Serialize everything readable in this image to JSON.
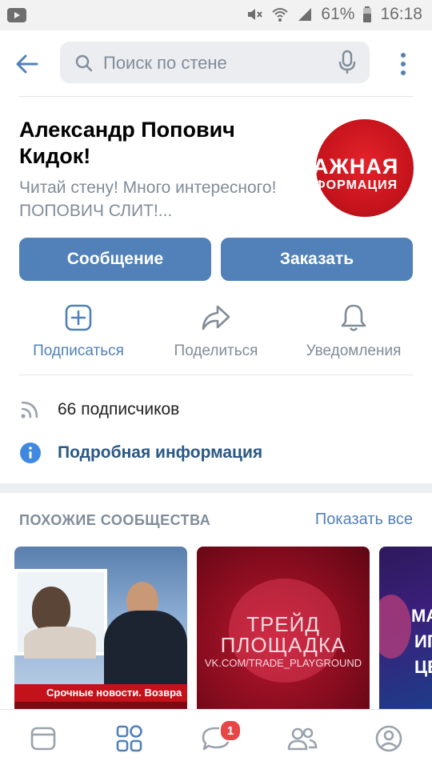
{
  "status_bar": {
    "battery": "61%",
    "time": "16:18"
  },
  "search": {
    "placeholder": "Поиск по стене"
  },
  "group": {
    "name": "Александр Попович Кидок!",
    "status": "Читай стену! Много интересного! ПОПОВИЧ СЛИТ!...",
    "avatar_text_1": "АЖНАЯ",
    "avatar_text_2": "ФОРМАЦИЯ"
  },
  "buttons": {
    "message": "Сообщение",
    "order": "Заказать"
  },
  "actions": [
    {
      "label": "Подписаться",
      "icon": "plus-square-icon"
    },
    {
      "label": "Поделиться",
      "icon": "share-arrow-icon"
    },
    {
      "label": "Уведомления",
      "icon": "bell-icon"
    }
  ],
  "info": {
    "subscribers": "66 подписчиков",
    "details": "Подробная информация"
  },
  "similar": {
    "title": "ПОХОЖИЕ СООБЩЕСТВА",
    "show_all": "Показать все",
    "cards": [
      {
        "banner": "Срочные новости. Возвра"
      },
      {
        "line1": "ТРЕЙД",
        "line2": "ПЛОЩАДКА",
        "line3": "VK.COM/TRADE_PLAYGROUND"
      },
      {
        "line1": "МА",
        "line2": "ИГ",
        "line3": "ЦЕ"
      }
    ]
  },
  "nav": {
    "messages_badge": "1"
  },
  "colors": {
    "accent": "#5181b8",
    "link": "#2a5885",
    "badge": "#e64646"
  }
}
